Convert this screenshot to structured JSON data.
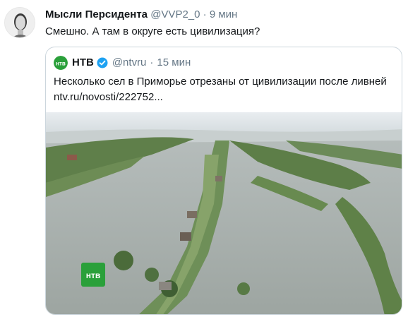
{
  "tweet": {
    "author_name": "Мысли Персидента",
    "author_handle": "@VVP2_0",
    "separator": "·",
    "time": "9 мин",
    "text": "Смешно. А там в округе есть цивилизация?",
    "avatar_icon": "avatar-portrait-icon"
  },
  "quote": {
    "author_name": "НТВ",
    "author_handle": "@ntvru",
    "separator": "·",
    "time": "15 мин",
    "text": "Несколько сел в Приморье отрезаны от цивилизации после ливней",
    "link": "ntv.ru/novosti/222752...",
    "logo_icon": "ntv-logo-icon",
    "verified_icon": "verified-badge-icon",
    "media_icon": "flood-photo-image"
  },
  "colors": {
    "text": "#14171a",
    "muted": "#657786",
    "border": "#ccd6dd",
    "verified": "#1da1f2",
    "ntv_green": "#2aa03a"
  }
}
